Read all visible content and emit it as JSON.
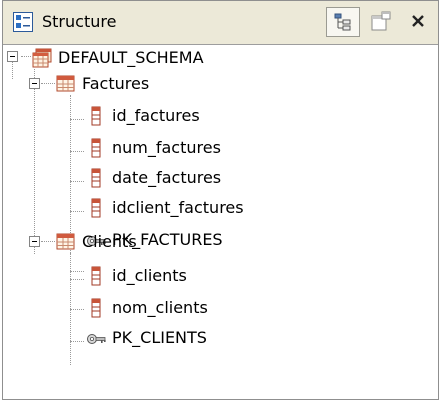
{
  "panel": {
    "title": "Structure"
  },
  "tree": {
    "schema": {
      "label": "DEFAULT_SCHEMA",
      "tables": [
        {
          "label": "Factures",
          "columns": [
            "id_factures",
            "num_factures",
            "date_factures",
            "idclient_factures"
          ],
          "key": "PK_FACTURES"
        },
        {
          "label": "Clients",
          "columns": [
            "id_clients",
            "nom_clients"
          ],
          "key": "PK_CLIENTS"
        }
      ]
    }
  }
}
